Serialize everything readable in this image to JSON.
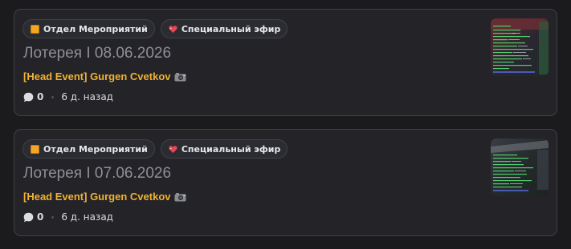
{
  "posts": [
    {
      "tags": [
        {
          "icon": "folder-icon",
          "label": "Отдел Мероприятий"
        },
        {
          "icon": "sparkling-heart-icon",
          "label": "Специальный эфир"
        }
      ],
      "title": "Лотерея I 08.06.2026",
      "author": "[Head Event] Gurgen Cvetkov",
      "author_icon": "camera-icon",
      "comments": "0",
      "age": "6 д. назад",
      "thumbnail": "terminal-screenshot-thumbnail"
    },
    {
      "tags": [
        {
          "icon": "folder-icon",
          "label": "Отдел Мероприятий"
        },
        {
          "icon": "sparkling-heart-icon",
          "label": "Специальный эфир"
        }
      ],
      "title": "Лотерея I 07.06.2026",
      "author": "[Head Event] Gurgen Cvetkov",
      "author_icon": "camera-icon",
      "comments": "0",
      "age": "6 д. назад",
      "thumbnail": "terminal-screenshot-thumbnail"
    }
  ],
  "colors": {
    "background": "#1b1b1e",
    "card": "#232328",
    "card_border": "#3f4147",
    "title": "#8e9097",
    "author": "#f0b232",
    "folder": "#f5a524",
    "heart": "#e8455a"
  }
}
